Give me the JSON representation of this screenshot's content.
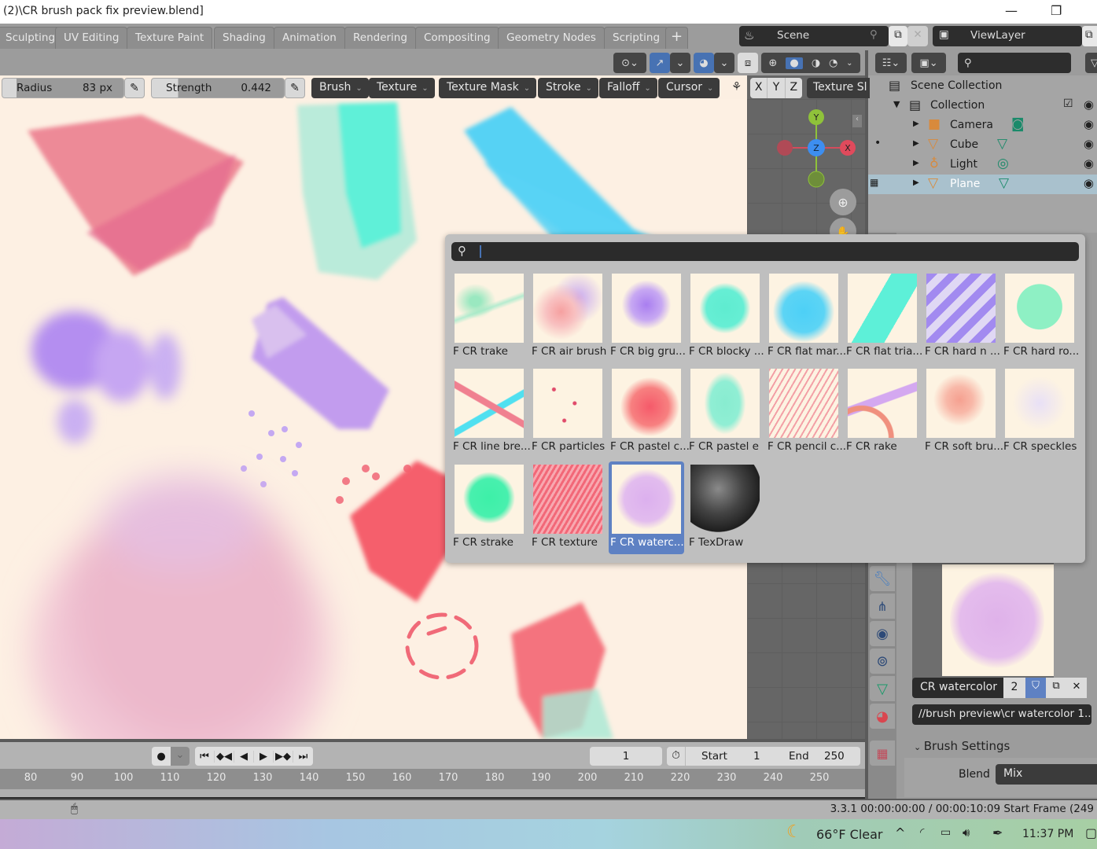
{
  "window": {
    "title": "(2)\\CR brush pack fix preview.blend]",
    "minimize_icon": "minimize-icon",
    "maximize_icon": "restore-icon"
  },
  "workspace_tabs": [
    "Sculpting",
    "UV Editing",
    "Texture Paint",
    "Shading",
    "Animation",
    "Rendering",
    "Compositing",
    "Geometry Nodes",
    "Scripting",
    "+"
  ],
  "scene": {
    "label": "Scene",
    "icon": "scene-icon"
  },
  "view_layer": {
    "label": "ViewLayer",
    "icon": "viewlayer-icon"
  },
  "tool_settings": {
    "radius_label": "Radius",
    "radius_value": "83 px",
    "strength_label": "Strength",
    "strength_value": "0.442",
    "strength_fraction": 0.442,
    "dropdowns": [
      "Brush",
      "Texture",
      "Texture Mask",
      "Stroke",
      "Falloff",
      "Cursor"
    ],
    "symmetry": [
      "X",
      "Y",
      "Z"
    ],
    "texture_slot": "Texture Sl"
  },
  "gizmo": {
    "x": "X",
    "y": "Y",
    "z": "Z"
  },
  "outliner": {
    "scene_collection": "Scene Collection",
    "collection": "Collection",
    "objects": [
      {
        "name": "Camera",
        "type_icon": "camera-icon",
        "data_icon": "camera-data-icon",
        "selected": false
      },
      {
        "name": "Cube",
        "type_icon": "mesh-icon",
        "data_icon": "mesh-data-icon",
        "selected": false
      },
      {
        "name": "Light",
        "type_icon": "light-icon",
        "data_icon": "light-data-icon",
        "selected": false
      },
      {
        "name": "Plane",
        "type_icon": "mesh-icon",
        "data_icon": "mesh-data-icon",
        "selected": true
      }
    ]
  },
  "brush_popup": {
    "search_value": "",
    "items": [
      {
        "label": "F CR  trake",
        "selected": false
      },
      {
        "label": "F CR air brush",
        "selected": false
      },
      {
        "label": "F CR big gru...",
        "selected": false
      },
      {
        "label": "F CR blocky ...",
        "selected": false
      },
      {
        "label": "F CR flat mar...",
        "selected": false
      },
      {
        "label": "F CR flat tria...",
        "selected": false
      },
      {
        "label": "F CR hard n ...",
        "selected": false
      },
      {
        "label": "F CR hard ro...",
        "selected": false
      },
      {
        "label": "F CR line bre...",
        "selected": false
      },
      {
        "label": "F CR particles",
        "selected": false
      },
      {
        "label": "F CR pastel c...",
        "selected": false
      },
      {
        "label": "F CR pastel e",
        "selected": false
      },
      {
        "label": "F CR pencil c...",
        "selected": false
      },
      {
        "label": "F CR rake",
        "selected": false
      },
      {
        "label": "F CR soft bru...",
        "selected": false
      },
      {
        "label": "F CR speckles",
        "selected": false
      },
      {
        "label": "F CR strake",
        "selected": false
      },
      {
        "label": "F CR texture",
        "selected": false
      },
      {
        "label": "F CR waterc...",
        "selected": true
      },
      {
        "label": "F TexDraw",
        "selected": false
      }
    ]
  },
  "properties": {
    "brush_name": "CR watercolor",
    "users": "2",
    "texture_path": "//brush preview\\cr watercolor 1....",
    "section": "Brush Settings",
    "blend_label": "Blend",
    "blend_value": "Mix"
  },
  "timeline": {
    "current_frame": "1",
    "start_label": "Start",
    "start_value": "1",
    "end_label": "End",
    "end_value": "250",
    "ticks": [
      "80",
      "90",
      "100",
      "110",
      "120",
      "130",
      "140",
      "150",
      "160",
      "170",
      "180",
      "190",
      "200",
      "210",
      "220",
      "230",
      "240",
      "250"
    ]
  },
  "status_bar": {
    "text": "3.3.1  00:00:00:00 / 00:00:10:09  Start Frame (249"
  },
  "taskbar": {
    "weather": "66°F  Clear",
    "time": "11:37 PM"
  },
  "colors": {
    "accent": "#4772b3",
    "selected_row": "#a9c1cd",
    "canvas": "#fdf0e3"
  }
}
